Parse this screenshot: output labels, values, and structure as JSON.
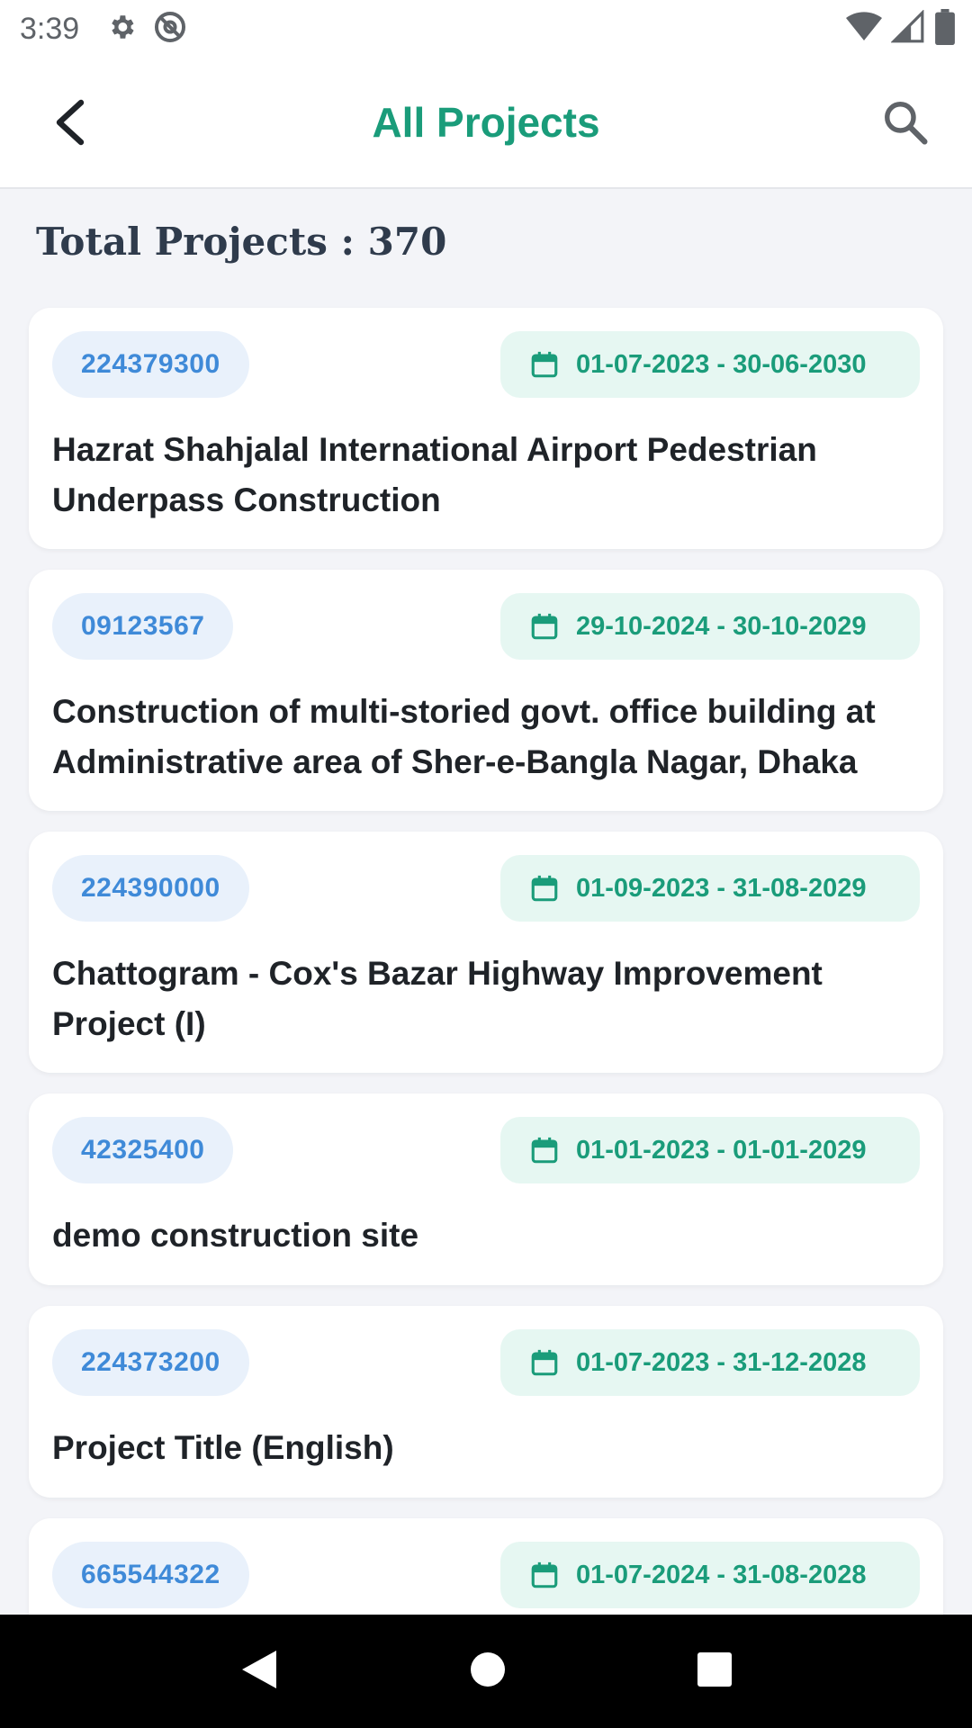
{
  "status_bar": {
    "time": "3:39",
    "icons_left": [
      "gear-icon",
      "at-sign-icon"
    ],
    "icons_right": [
      "wifi-icon",
      "signal-icon",
      "battery-icon"
    ]
  },
  "app_bar": {
    "title": "All Projects",
    "back_icon": "chevron-left-icon",
    "search_icon": "search-icon",
    "title_color": "#1a9c7a"
  },
  "summary": {
    "total_label": "Total Projects : 370"
  },
  "projects": [
    {
      "code": "224379300",
      "dates": "01-07-2023 - 30-06-2030",
      "title": "Hazrat Shahjalal International Airport Pedestrian Underpass Construction"
    },
    {
      "code": "09123567",
      "dates": "29-10-2024 - 30-10-2029",
      "title": "Construction of multi-storied govt. office building at Administrative area of Sher-e-Bangla Nagar, Dhaka"
    },
    {
      "code": "224390000",
      "dates": "01-09-2023 - 31-08-2029",
      "title": "Chattogram - Cox's Bazar Highway Improvement Project (I)"
    },
    {
      "code": "42325400",
      "dates": "01-01-2023 - 01-01-2029",
      "title": "demo construction site"
    },
    {
      "code": "224373200",
      "dates": "01-07-2023 - 31-12-2028",
      "title": "Project Title (English)"
    },
    {
      "code": "665544322",
      "dates": "01-07-2024 - 31-08-2028",
      "title": ""
    }
  ],
  "colors": {
    "code_chip_bg": "#e9f1fb",
    "code_chip_text": "#3f8ad8",
    "date_chip_bg": "#e6f7f2",
    "date_chip_text": "#1a9c7a"
  },
  "nav_bar": {
    "icons": [
      "back-triangle-icon",
      "home-circle-icon",
      "recents-square-icon"
    ]
  }
}
